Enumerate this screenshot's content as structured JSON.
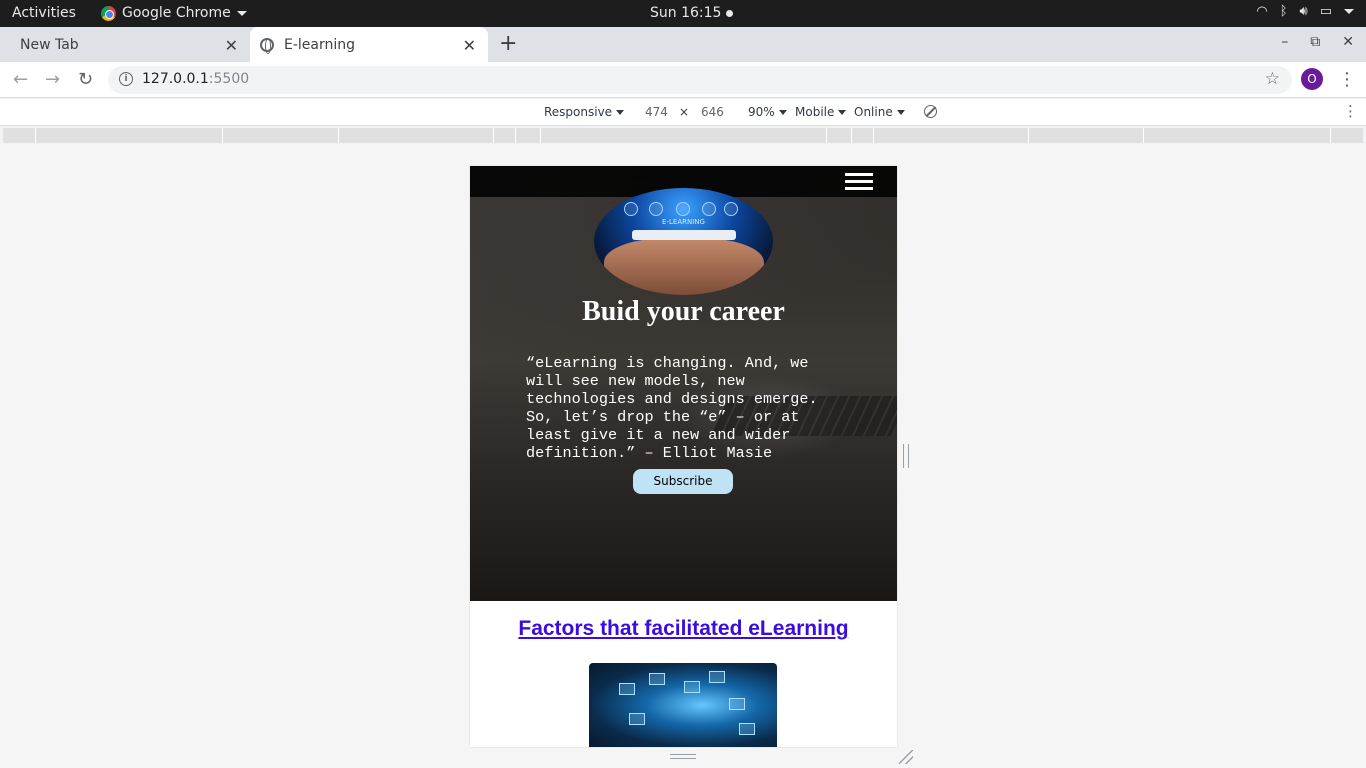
{
  "system_bar": {
    "activities": "Activities",
    "app_name": "Google Chrome",
    "clock": "Sun 16:15"
  },
  "tabs": [
    {
      "title": "New Tab",
      "active": false
    },
    {
      "title": "E-learning",
      "active": true
    }
  ],
  "address_bar": {
    "host": "127.0.0.1",
    "port": ":5500"
  },
  "profile_initial": "O",
  "device_toolbar": {
    "mode": "Responsive",
    "width": "474",
    "times": "×",
    "height": "646",
    "zoom": "90%",
    "device_type": "Mobile",
    "throttling": "Online"
  },
  "page": {
    "hero_title": "Buid your career",
    "hero_image_label": "E-LEARNING",
    "quote": "“eLearning is changing. And, we will see new models, new technologies and designs emerge. So, let’s drop the “e” – or at least give it a new and wider definition.” – Elliot Masie",
    "subscribe_label": "Subscribe",
    "section_heading": "Factors that facilitated eLearning"
  }
}
